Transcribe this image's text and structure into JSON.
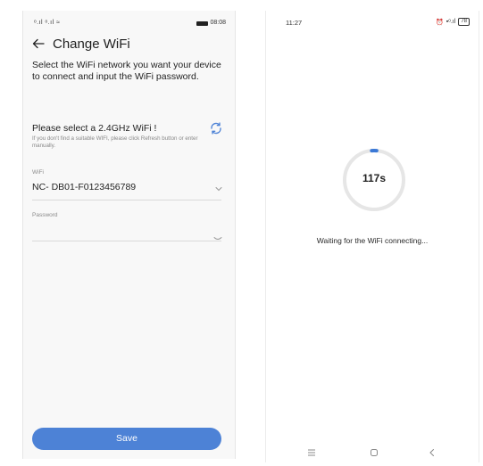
{
  "left_screen": {
    "status_bar": {
      "signal": "ᵒ.ıl ᵒ.ıl ≈",
      "time": "08:08"
    },
    "header": {
      "back_icon": "arrow-left-icon",
      "title": "Change WiFi"
    },
    "intro_text": "Select the WiFi network you want your device to connect and input the WiFi password.",
    "select_title": "Please select a 2.4GHz WiFi !",
    "hint_text": "If you don't find a suitable WIFI, please click Refresh button or enter manually.",
    "wifi_field": {
      "label": "WiFi",
      "value": "NC- DB01-F0123456789"
    },
    "password_field": {
      "label": "Password",
      "value": ""
    },
    "save_button": "Save",
    "accent_color": "#4d82d6"
  },
  "right_screen": {
    "status_bar": {
      "time": "11:27",
      "battery": "78"
    },
    "countdown": "117s",
    "progress_fraction": 0.02,
    "waiting_text": "Waiting for the WiFi connecting...",
    "nav_icons": [
      "menu-icon",
      "home-icon",
      "back-icon"
    ]
  }
}
